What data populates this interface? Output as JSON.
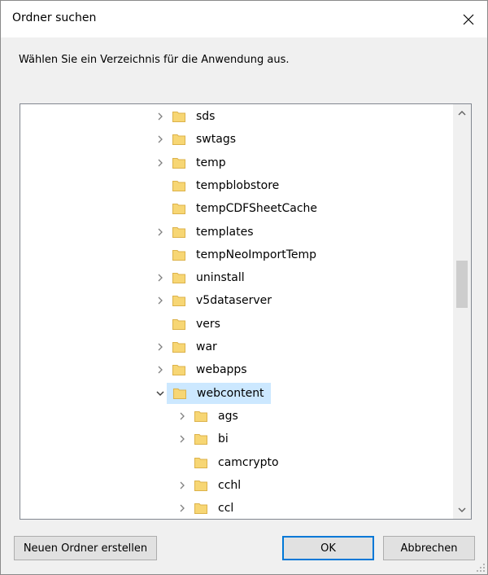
{
  "window": {
    "title": "Ordner suchen",
    "instruction": "Wählen Sie ein Verzeichnis für die Anwendung aus."
  },
  "tree": {
    "items": [
      {
        "label": "sds",
        "level": 0,
        "expander": "collapsed"
      },
      {
        "label": "swtags",
        "level": 0,
        "expander": "collapsed"
      },
      {
        "label": "temp",
        "level": 0,
        "expander": "collapsed"
      },
      {
        "label": "tempblobstore",
        "level": 0,
        "expander": "none"
      },
      {
        "label": "tempCDFSheetCache",
        "level": 0,
        "expander": "none"
      },
      {
        "label": "templates",
        "level": 0,
        "expander": "collapsed"
      },
      {
        "label": "tempNeoImportTemp",
        "level": 0,
        "expander": "none"
      },
      {
        "label": "uninstall",
        "level": 0,
        "expander": "collapsed"
      },
      {
        "label": "v5dataserver",
        "level": 0,
        "expander": "collapsed"
      },
      {
        "label": "vers",
        "level": 0,
        "expander": "none"
      },
      {
        "label": "war",
        "level": 0,
        "expander": "collapsed"
      },
      {
        "label": "webapps",
        "level": 0,
        "expander": "collapsed"
      },
      {
        "label": "webcontent",
        "level": 0,
        "expander": "expanded",
        "selected": true
      },
      {
        "label": "ags",
        "level": 1,
        "expander": "collapsed"
      },
      {
        "label": "bi",
        "level": 1,
        "expander": "collapsed"
      },
      {
        "label": "camcrypto",
        "level": 1,
        "expander": "none"
      },
      {
        "label": "cchl",
        "level": 1,
        "expander": "collapsed"
      },
      {
        "label": "ccl",
        "level": 1,
        "expander": "collapsed"
      }
    ]
  },
  "buttons": {
    "new_folder": "Neuen Ordner erstellen",
    "ok": "OK",
    "cancel": "Abbrechen"
  },
  "colors": {
    "folder_fill": "#f7d674",
    "folder_edge": "#dcb24a",
    "selection": "#cce8ff",
    "accent": "#0078d7"
  }
}
